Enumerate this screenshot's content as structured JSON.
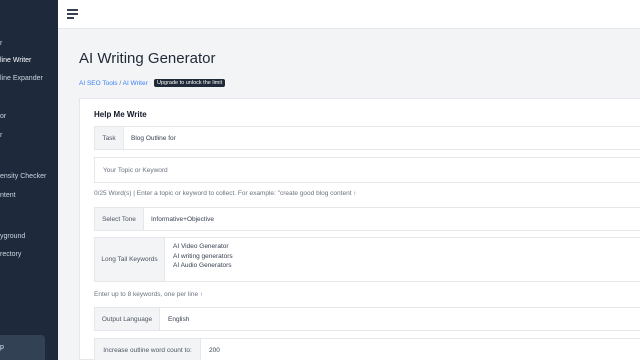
{
  "sidebar": {
    "items": [
      {
        "label": "r"
      },
      {
        "label": "line Writer"
      },
      {
        "label": "line Expander"
      },
      {
        "label": "or"
      },
      {
        "label": "r"
      },
      {
        "label": "ensity Checker"
      },
      {
        "label": "ntent"
      },
      {
        "label": "yground"
      },
      {
        "label": "rectory"
      }
    ],
    "bottom_label": "p"
  },
  "main": {
    "title": "AI Writing Generator",
    "breadcrumb": {
      "part1": "AI SEO Tools",
      "sep": " / ",
      "part2": "AI Writer"
    },
    "badge": "Upgrade to unlock the limit"
  },
  "form": {
    "title": "Help Me Write",
    "task": {
      "label": "Task",
      "value": "Blog Outline for"
    },
    "topic": {
      "placeholder": "Your Topic or Keyword"
    },
    "topic_hint": "0/25 Word(s) | Enter a topic or keyword to collect. For example: \"create good blog content ↑",
    "tone": {
      "label": "Select Tone",
      "value": "Informative+Objective"
    },
    "keywords": {
      "label": "Long Tail Keywords",
      "lines": [
        "AI Video Generator",
        "AI writing generators",
        "AI Audio Generators"
      ]
    },
    "keywords_hint": "Enter up to 8 keywords, one per line ↑",
    "language": {
      "label": "Output Language",
      "value": "English"
    },
    "wordcount": {
      "label": "Increase outline word count to:",
      "value": "200"
    }
  }
}
